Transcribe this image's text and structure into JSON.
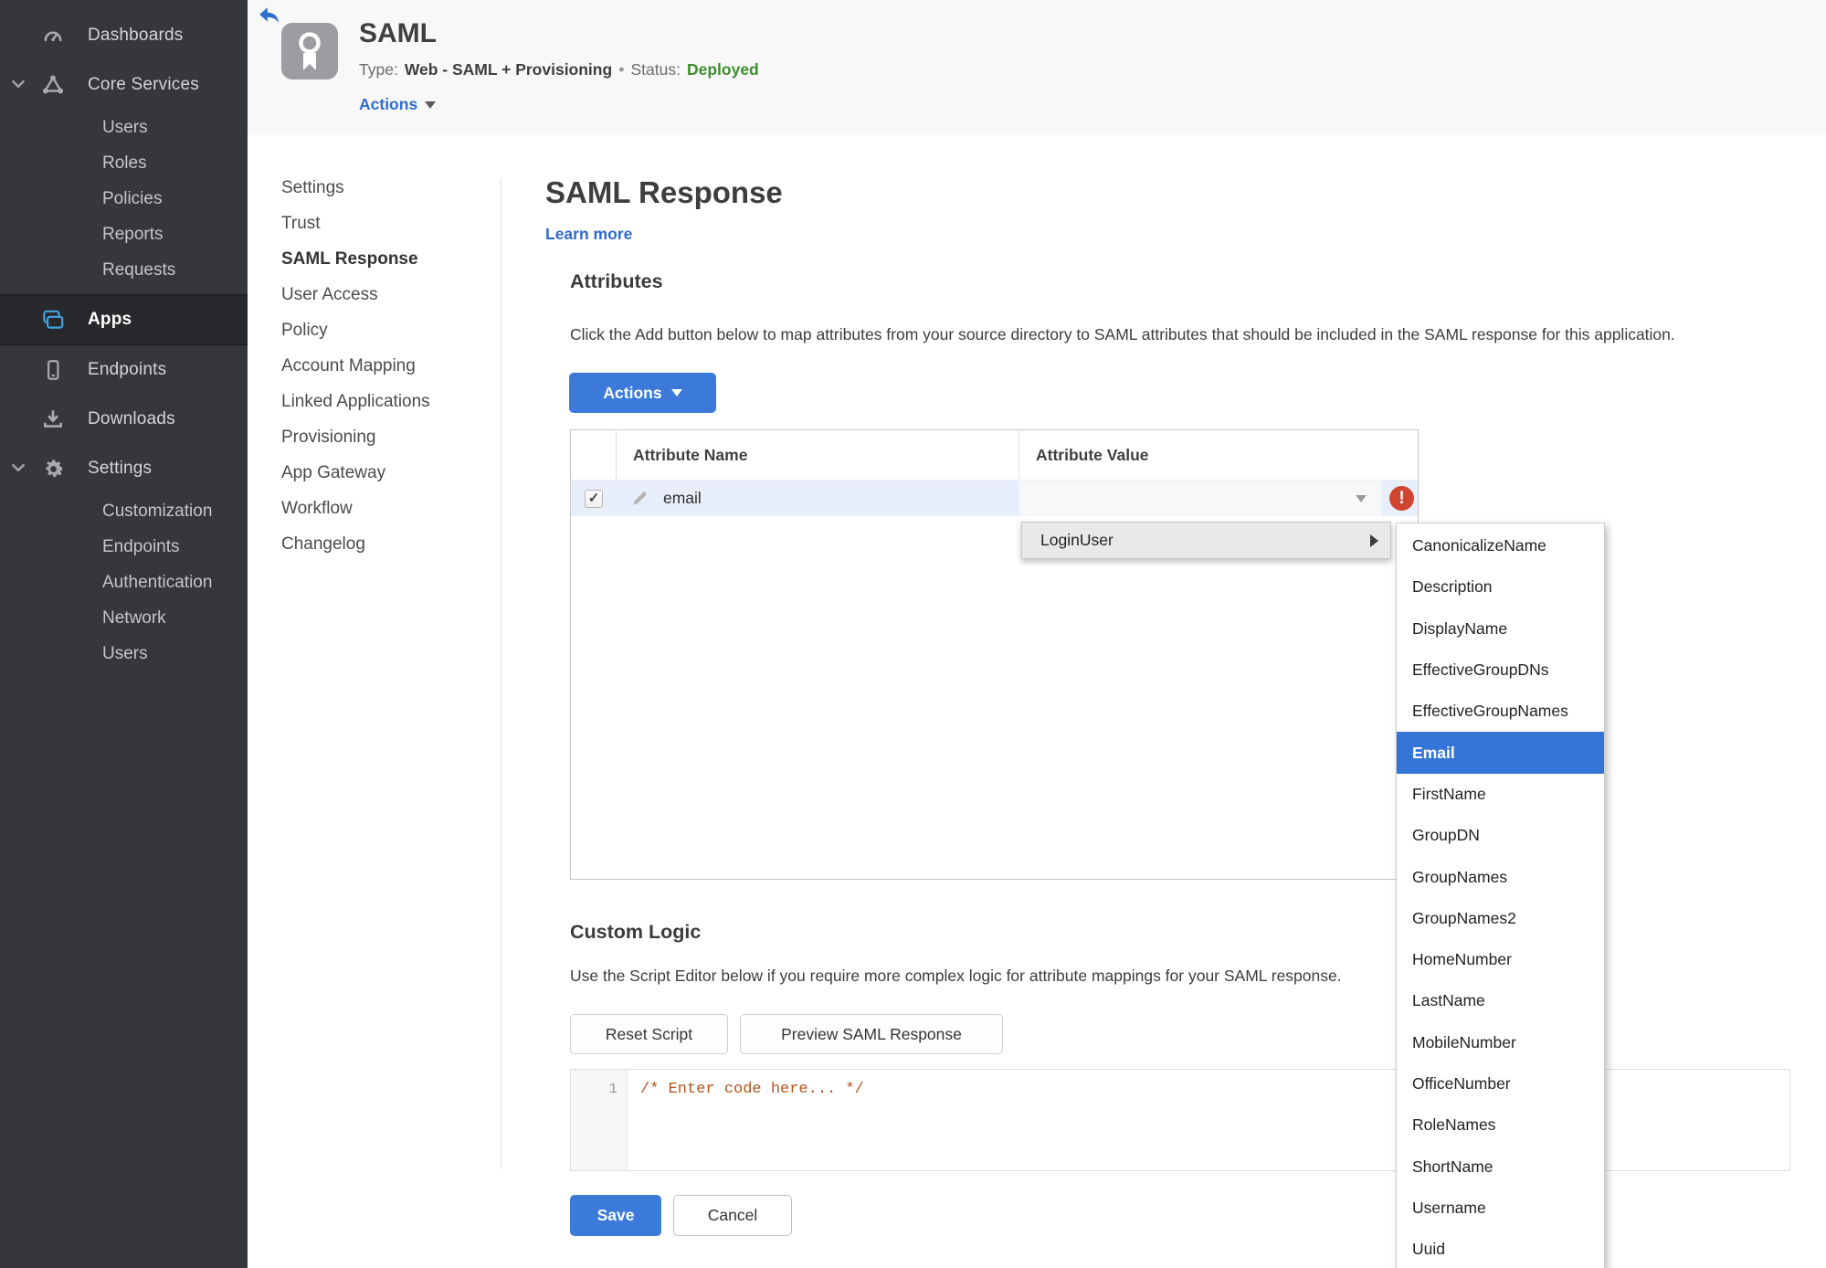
{
  "colors": {
    "accent_blue": "#3b7ad8",
    "link_blue": "#2e6bce",
    "status_green": "#3e8e2d",
    "error_red": "#d0452f",
    "row_highlight": "#e8effa",
    "sidebar_bg": "#35373a",
    "code_comment": "#b2551c"
  },
  "sidebar": {
    "items": [
      {
        "label": "Dashboards",
        "icon": "gauge-icon"
      },
      {
        "label": "Core Services",
        "icon": "core-services-icon",
        "expanded": true,
        "children": [
          "Users",
          "Roles",
          "Policies",
          "Reports",
          "Requests"
        ]
      },
      {
        "label": "Apps",
        "icon": "apps-icon",
        "active": true
      },
      {
        "label": "Endpoints",
        "icon": "mobile-device-icon"
      },
      {
        "label": "Downloads",
        "icon": "download-icon"
      },
      {
        "label": "Settings",
        "icon": "gear-icon",
        "expanded": true,
        "children": [
          "Customization",
          "Endpoints",
          "Authentication",
          "Network",
          "Users"
        ]
      }
    ]
  },
  "header": {
    "back_icon": "back-arrow-icon",
    "app_icon": "award-ribbon-icon",
    "title": "SAML",
    "type_label": "Type:",
    "type_value": "Web - SAML + Provisioning",
    "separator": "•",
    "status_label": "Status:",
    "status_value": "Deployed",
    "actions_label": "Actions"
  },
  "subnav": {
    "items": [
      {
        "label": "Settings"
      },
      {
        "label": "Trust"
      },
      {
        "label": "SAML Response",
        "active": true
      },
      {
        "label": "User Access"
      },
      {
        "label": "Policy"
      },
      {
        "label": "Account Mapping"
      },
      {
        "label": "Linked Applications"
      },
      {
        "label": "Provisioning"
      },
      {
        "label": "App Gateway"
      },
      {
        "label": "Workflow"
      },
      {
        "label": "Changelog"
      }
    ]
  },
  "main": {
    "title": "SAML Response",
    "learn_more_label": "Learn more",
    "attributes_heading": "Attributes",
    "attributes_description": "Click the Add button below to map attributes from your source directory to SAML attributes that should be included in the SAML response for this application.",
    "actions_button_label": "Actions",
    "table": {
      "columns": [
        "Attribute Name",
        "Attribute Value"
      ],
      "row": {
        "name": "email",
        "value": "",
        "checked": true,
        "error": true
      }
    },
    "custom_logic_heading": "Custom Logic",
    "custom_logic_description": "Use the Script Editor below if you require more complex logic for attribute mappings for your SAML response.",
    "reset_button_label": "Reset Script",
    "preview_button_label": "Preview SAML Response",
    "editor": {
      "line_number": "1",
      "code": "/* Enter code here... */"
    },
    "save_button_label": "Save",
    "cancel_button_label": "Cancel"
  },
  "context_menu": {
    "label": "LoginUser"
  },
  "submenu": {
    "items": [
      {
        "label": "CanonicalizeName"
      },
      {
        "label": "Description"
      },
      {
        "label": "DisplayName"
      },
      {
        "label": "EffectiveGroupDNs"
      },
      {
        "label": "EffectiveGroupNames"
      },
      {
        "label": "Email",
        "selected": true
      },
      {
        "label": "FirstName"
      },
      {
        "label": "GroupDN"
      },
      {
        "label": "GroupNames"
      },
      {
        "label": "GroupNames2"
      },
      {
        "label": "HomeNumber"
      },
      {
        "label": "LastName"
      },
      {
        "label": "MobileNumber"
      },
      {
        "label": "OfficeNumber"
      },
      {
        "label": "RoleNames"
      },
      {
        "label": "ShortName"
      },
      {
        "label": "Username"
      },
      {
        "label": "Uuid"
      }
    ]
  }
}
